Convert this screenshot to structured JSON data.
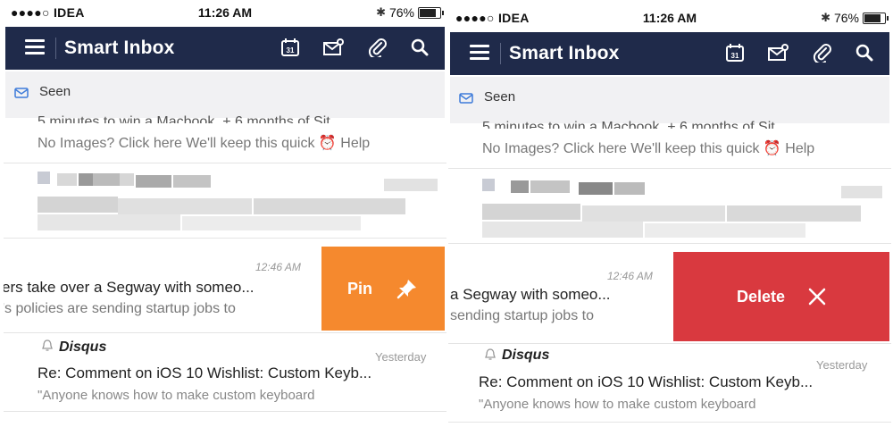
{
  "status_bar": {
    "carrier": "●●●●○ IDEA",
    "time": "11:26 AM",
    "battery": "76%"
  },
  "appbar": {
    "title": "Smart Inbox",
    "icons": [
      "menu-icon",
      "calendar-icon",
      "mail-notify-icon",
      "attachment-icon",
      "search-icon"
    ],
    "calendar_day": "31",
    "bg_color": "#1f2a4a"
  },
  "seen": {
    "label": "Seen"
  },
  "emails": {
    "snippet_partial": "5 minutes to win a Macbook, + 6 months of Sit...",
    "snippet_line_1": "No Images? Click here We'll keep this quick",
    "snippet_line_2": "Help",
    "swipe_time": "12:46 AM",
    "left_swipe_subject": "ers take over a Segway with someo...",
    "left_swipe_preview": "'s policies are sending startup jobs to",
    "right_swipe_subject": "a Segway with someo...",
    "right_swipe_preview": "sending startup jobs to",
    "disqus_sender": "Disqus",
    "disqus_time": "Yesterday",
    "disqus_subject": "Re: Comment on iOS 10 Wishlist: Custom Keyb...",
    "disqus_preview": "\"Anyone knows how to make custom keyboard"
  },
  "actions": {
    "pin_label": "Pin",
    "pin_color": "#f5892e",
    "delete_label": "Delete",
    "delete_color": "#d9393f"
  }
}
